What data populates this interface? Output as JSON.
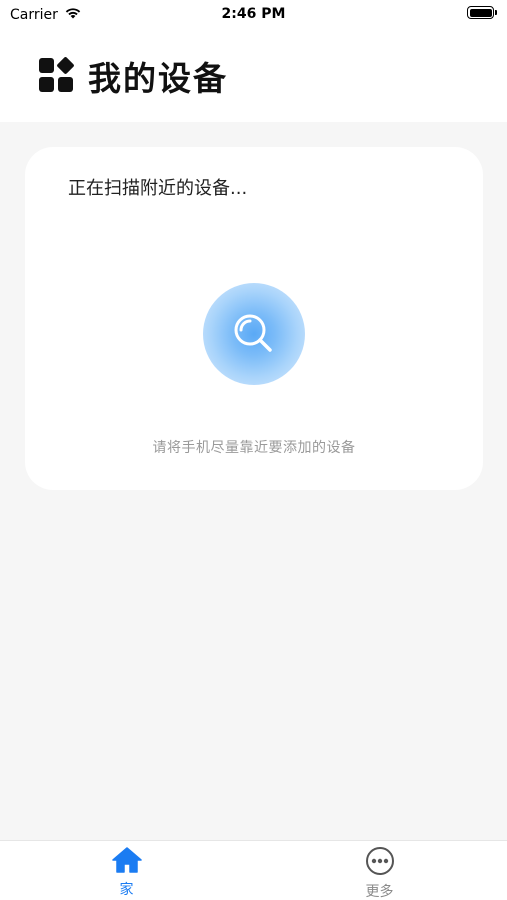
{
  "status_bar": {
    "carrier": "Carrier",
    "time": "2:46 PM"
  },
  "header": {
    "title": "我的设备",
    "icon": "apps-grid-icon"
  },
  "scan_card": {
    "status_text": "正在扫描附近的设备...",
    "hint_text": "请将手机尽量靠近要添加的设备",
    "button_icon": "search-icon"
  },
  "tab_bar": {
    "tabs": [
      {
        "label": "家",
        "icon": "home-icon",
        "active": true
      },
      {
        "label": "更多",
        "icon": "more-icon",
        "active": false
      }
    ]
  },
  "colors": {
    "accent": "#1b7cf2",
    "background": "#f6f6f6",
    "card": "#ffffff",
    "inactive": "#8a8a8a"
  }
}
